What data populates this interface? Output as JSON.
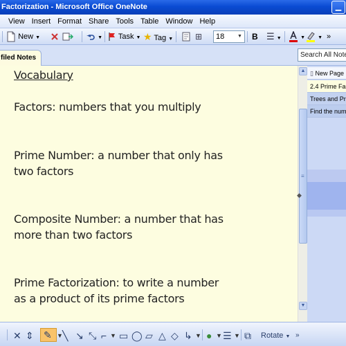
{
  "window": {
    "title": "Factorization - Microsoft Office OneNote",
    "minimize_glyph": "▁"
  },
  "menu": [
    "View",
    "Insert",
    "Format",
    "Share",
    "Tools",
    "Table",
    "Window",
    "Help"
  ],
  "toolbar": {
    "new_label": "New",
    "task_label": "Task",
    "tag_label": "Tag",
    "font_size": "18",
    "bold_label": "B"
  },
  "tabs": {
    "active_label": "filed Notes"
  },
  "search": {
    "placeholder": "Search All Notebo"
  },
  "note": {
    "heading": "Vocabulary",
    "lines": [
      "Factors: numbers that you multiply",
      "Prime Number: a number that only has",
      "two factors",
      "Composite Number: a number that has",
      "more than two factors",
      "Prime Factorization: to write a number",
      "as a product of its prime factors"
    ]
  },
  "pages": {
    "new_page_label": "New Page",
    "items": [
      "2.4 Prime Fa",
      "Trees and Pr",
      "Find the num"
    ]
  },
  "drawing_toolbar": {
    "rotate_label": "Rotate"
  },
  "colors": {
    "titlebar": "#0a4bd3",
    "note_background": "#fdfde0",
    "toolbar": "#dde7f9"
  }
}
